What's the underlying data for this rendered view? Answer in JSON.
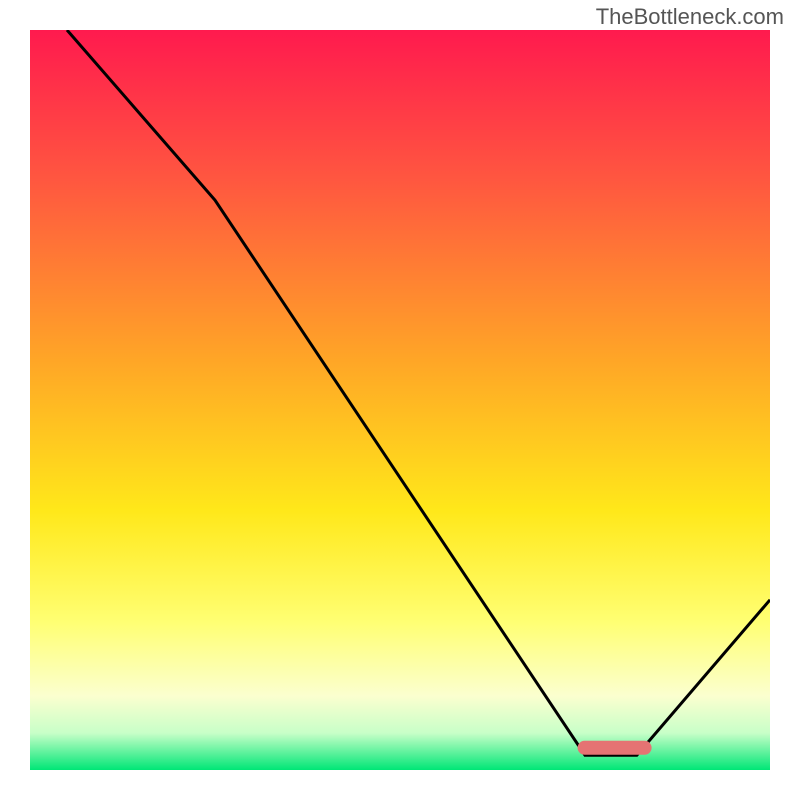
{
  "watermark": "TheBottleneck.com",
  "chart_data": {
    "type": "line",
    "title": "",
    "xlabel": "",
    "ylabel": "",
    "xlim": [
      0,
      100
    ],
    "ylim": [
      0,
      100
    ],
    "grid": false,
    "series": [
      {
        "name": "bottleneck-curve",
        "x": [
          5,
          25,
          75,
          82,
          100
        ],
        "values": [
          100,
          77,
          2,
          2,
          23
        ]
      }
    ],
    "annotations": [
      {
        "name": "optimal-bar",
        "x_start": 74,
        "x_end": 84,
        "y": 3
      }
    ],
    "gradient_stops": [
      {
        "offset": 0.0,
        "color": "#ff1a4e"
      },
      {
        "offset": 0.2,
        "color": "#ff5640"
      },
      {
        "offset": 0.45,
        "color": "#ffa726"
      },
      {
        "offset": 0.65,
        "color": "#ffe81a"
      },
      {
        "offset": 0.8,
        "color": "#ffff73"
      },
      {
        "offset": 0.9,
        "color": "#fbffcf"
      },
      {
        "offset": 0.95,
        "color": "#c8ffc8"
      },
      {
        "offset": 1.0,
        "color": "#00e676"
      }
    ],
    "marker_color": "#e57373"
  }
}
